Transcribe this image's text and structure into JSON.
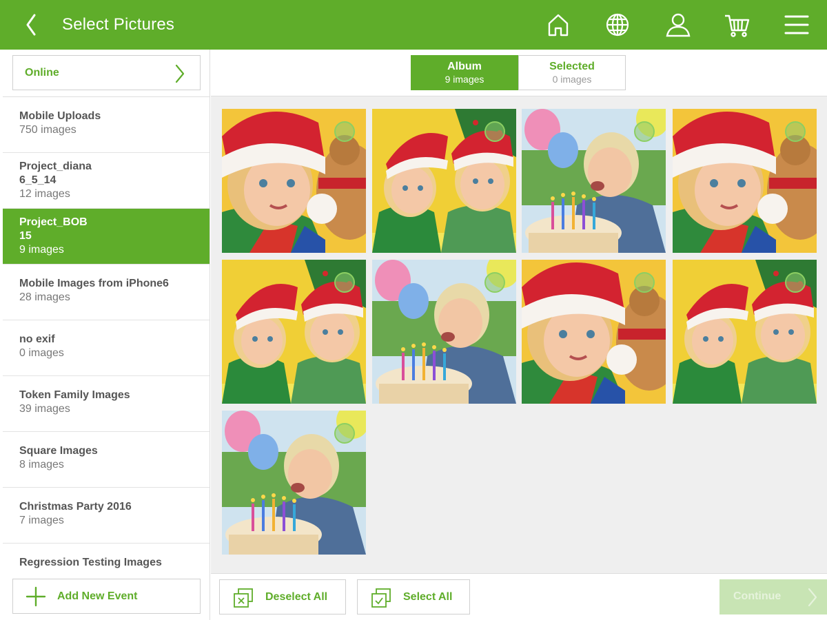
{
  "header": {
    "title": "Select Pictures",
    "icons": [
      "back-icon",
      "home-icon",
      "globe-icon",
      "user-icon",
      "cart-icon",
      "menu-icon"
    ],
    "color": "#5fad2a"
  },
  "sidebar": {
    "online_label": "Online",
    "albums": [
      {
        "name": "Mobile Uploads",
        "count": "750 images",
        "active": false
      },
      {
        "name": "Project_diana\n6_5_14",
        "count": "12 images",
        "active": false
      },
      {
        "name": "Project_BOB\n15",
        "count": "9 images",
        "active": true
      },
      {
        "name": "Mobile Images from iPhone6",
        "count": "28 images",
        "active": false
      },
      {
        "name": "no exif",
        "count": "0 images",
        "active": false
      },
      {
        "name": "Token Family Images",
        "count": "39 images",
        "active": false
      },
      {
        "name": "Square Images",
        "count": "8 images",
        "active": false
      },
      {
        "name": "Christmas Party 2016",
        "count": "7 images",
        "active": false
      },
      {
        "name": "Regression Testing Images",
        "count": "",
        "active": false
      }
    ],
    "add_event_label": "Add New Event"
  },
  "tabs": {
    "album": {
      "label": "Album",
      "count": "9 images"
    },
    "selected": {
      "label": "Selected",
      "count": "0 images"
    }
  },
  "photos": [
    {
      "scene": "girl-santa-hat-teddy"
    },
    {
      "scene": "two-kids-santa-hats"
    },
    {
      "scene": "boy-birthday-cake"
    },
    {
      "scene": "girl-santa-hat-teddy"
    },
    {
      "scene": "two-kids-santa-hats"
    },
    {
      "scene": "boy-birthday-cake"
    },
    {
      "scene": "girl-santa-hat-teddy"
    },
    {
      "scene": "two-kids-santa-hats"
    },
    {
      "scene": "boy-birthday-cake"
    }
  ],
  "footer": {
    "deselect_label": "Deselect All",
    "select_label": "Select All",
    "continue_label": "Continue"
  }
}
